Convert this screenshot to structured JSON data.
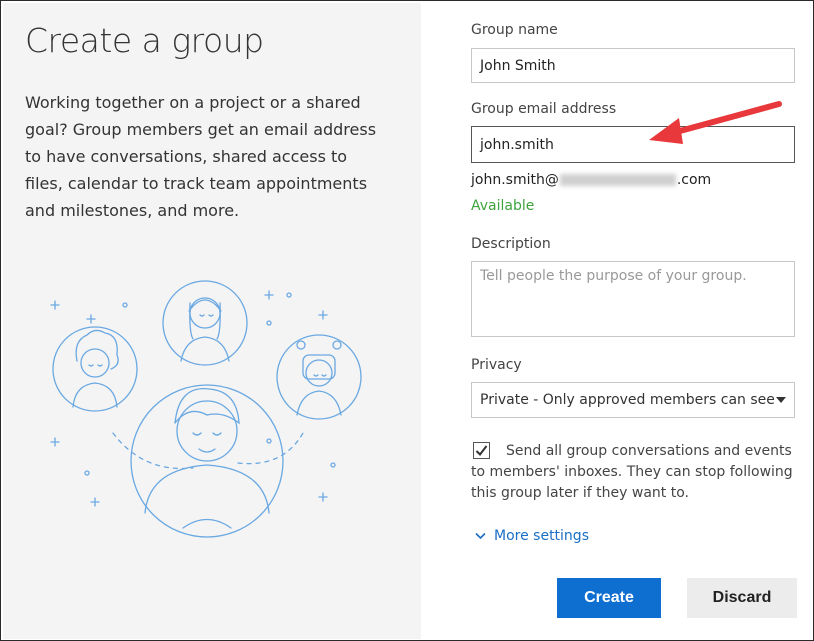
{
  "panel": {
    "title": "Create a group",
    "description": "Working together on a project or a shared goal? Group members get an email address to have conversations, shared access to files, calendar to track team appointments and milestones, and more."
  },
  "form": {
    "group_name_label": "Group name",
    "group_name_value": "John Smith",
    "group_email_label": "Group email address",
    "group_email_value": "john.smith",
    "email_prefix": "john.smith@",
    "email_suffix": ".com",
    "availability": "Available",
    "description_label": "Description",
    "description_placeholder": "Tell people the purpose of your group.",
    "privacy_label": "Privacy",
    "privacy_value": "Private - Only approved members can see what's inside",
    "send_checkbox_checked": true,
    "send_checkbox_text": "Send all group conversations and events to members' inboxes. They can stop following this group later if they want to.",
    "more_settings": "More settings"
  },
  "buttons": {
    "create": "Create",
    "discard": "Discard"
  },
  "colors": {
    "accent": "#0f6fd1",
    "available": "#3fa33f",
    "arrow": "#e8383b",
    "illustration": "#6aa8e2"
  }
}
